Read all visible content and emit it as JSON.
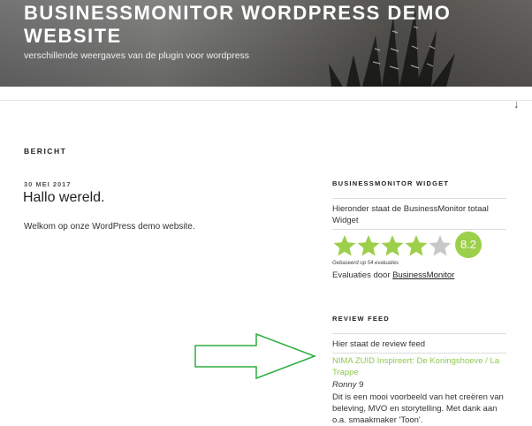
{
  "header": {
    "site_title": "BUSINESSMONITOR WORDPRESS DEMO WEBSITE",
    "site_description": "verschillende weergaves van de plugin voor wordpress"
  },
  "page": {
    "heading": "BERICHT"
  },
  "post": {
    "date": "30 MEI 2017",
    "title": "Hallo wereld.",
    "content": "Welkom op onze WordPress demo website."
  },
  "widget": {
    "title": "BUSINESSMONITOR WIDGET",
    "intro": "Hieronder staat de BusinessMonitor totaal Widget",
    "rating_stars": 4,
    "rating_max": 5,
    "score": "8.2",
    "based_on": "Gebaseerd op 54 evaluaties",
    "evals_prefix": "Evaluaties door",
    "evals_link": "BusinessMonitor",
    "star_color": "#9ccf4a"
  },
  "review_feed": {
    "title": "REVIEW FEED",
    "intro": "Hier staat de review feed",
    "link_text": "NIMA ZUID Inspireert: De Koningshoeve / La Trappe",
    "reviewer_name": "Ronny",
    "reviewer_score": "9",
    "review_text": "Dit is een mooi voorbeeld van het creëren van beleving, MVO en storytelling. Met dank aan o.a. smaakmaker 'Toon'.",
    "link_color": "#8fc850"
  },
  "annotation": {
    "arrow_color": "#2eae3e",
    "icon": "right-arrow-outline-icon"
  },
  "icons": {
    "scroll_down": "arrow-down-icon"
  }
}
